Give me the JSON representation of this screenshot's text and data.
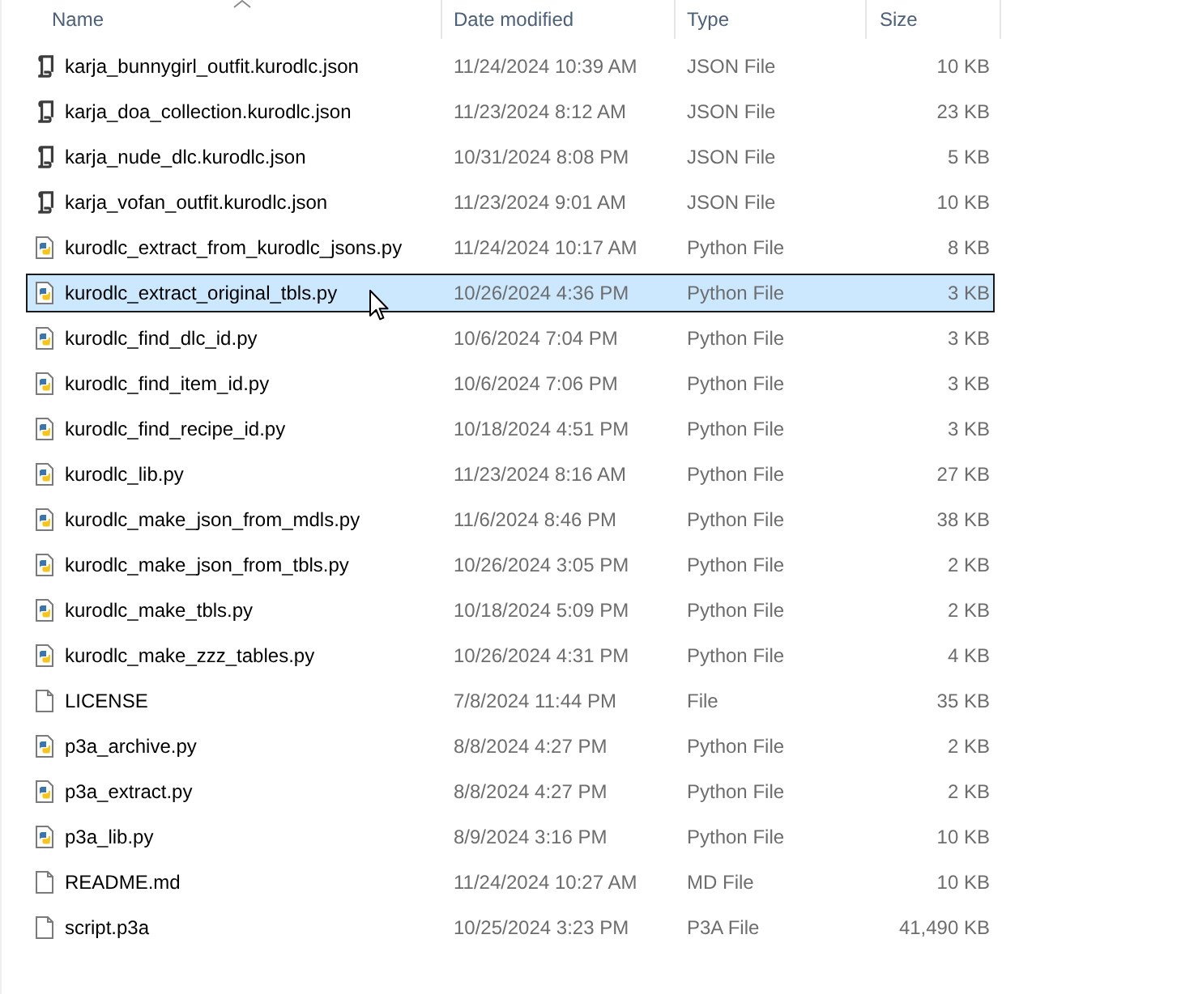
{
  "columns": [
    {
      "label": "Name",
      "sorted": true
    },
    {
      "label": "Date modified",
      "sorted": false
    },
    {
      "label": "Type",
      "sorted": false
    },
    {
      "label": "Size",
      "sorted": false
    }
  ],
  "rows": [
    {
      "kind": "script",
      "name": "karja_bunnygirl_outfit.kurodlc.json",
      "date_modified": "11/24/2024 10:39 AM",
      "type": "JSON File",
      "size": "10 KB",
      "selected": false
    },
    {
      "kind": "script",
      "name": "karja_doa_collection.kurodlc.json",
      "date_modified": "11/23/2024 8:12 AM",
      "type": "JSON File",
      "size": "23 KB",
      "selected": false
    },
    {
      "kind": "script",
      "name": "karja_nude_dlc.kurodlc.json",
      "date_modified": "10/31/2024 8:08 PM",
      "type": "JSON File",
      "size": "5 KB",
      "selected": false
    },
    {
      "kind": "script",
      "name": "karja_vofan_outfit.kurodlc.json",
      "date_modified": "11/23/2024 9:01 AM",
      "type": "JSON File",
      "size": "10 KB",
      "selected": false
    },
    {
      "kind": "python",
      "name": "kurodlc_extract_from_kurodlc_jsons.py",
      "date_modified": "11/24/2024 10:17 AM",
      "type": "Python File",
      "size": "8 KB",
      "selected": false
    },
    {
      "kind": "python",
      "name": "kurodlc_extract_original_tbls.py",
      "date_modified": "10/26/2024 4:36 PM",
      "type": "Python File",
      "size": "3 KB",
      "selected": true
    },
    {
      "kind": "python",
      "name": "kurodlc_find_dlc_id.py",
      "date_modified": "10/6/2024 7:04 PM",
      "type": "Python File",
      "size": "3 KB",
      "selected": false
    },
    {
      "kind": "python",
      "name": "kurodlc_find_item_id.py",
      "date_modified": "10/6/2024 7:06 PM",
      "type": "Python File",
      "size": "3 KB",
      "selected": false
    },
    {
      "kind": "python",
      "name": "kurodlc_find_recipe_id.py",
      "date_modified": "10/18/2024 4:51 PM",
      "type": "Python File",
      "size": "3 KB",
      "selected": false
    },
    {
      "kind": "python",
      "name": "kurodlc_lib.py",
      "date_modified": "11/23/2024 8:16 AM",
      "type": "Python File",
      "size": "27 KB",
      "selected": false
    },
    {
      "kind": "python",
      "name": "kurodlc_make_json_from_mdls.py",
      "date_modified": "11/6/2024 8:46 PM",
      "type": "Python File",
      "size": "38 KB",
      "selected": false
    },
    {
      "kind": "python",
      "name": "kurodlc_make_json_from_tbls.py",
      "date_modified": "10/26/2024 3:05 PM",
      "type": "Python File",
      "size": "2 KB",
      "selected": false
    },
    {
      "kind": "python",
      "name": "kurodlc_make_tbls.py",
      "date_modified": "10/18/2024 5:09 PM",
      "type": "Python File",
      "size": "2 KB",
      "selected": false
    },
    {
      "kind": "python",
      "name": "kurodlc_make_zzz_tables.py",
      "date_modified": "10/26/2024 4:31 PM",
      "type": "Python File",
      "size": "4 KB",
      "selected": false
    },
    {
      "kind": "blank",
      "name": "LICENSE",
      "date_modified": "7/8/2024 11:44 PM",
      "type": "File",
      "size": "35 KB",
      "selected": false
    },
    {
      "kind": "python",
      "name": "p3a_archive.py",
      "date_modified": "8/8/2024 4:27 PM",
      "type": "Python File",
      "size": "2 KB",
      "selected": false
    },
    {
      "kind": "python",
      "name": "p3a_extract.py",
      "date_modified": "8/8/2024 4:27 PM",
      "type": "Python File",
      "size": "2 KB",
      "selected": false
    },
    {
      "kind": "python",
      "name": "p3a_lib.py",
      "date_modified": "8/9/2024 3:16 PM",
      "type": "Python File",
      "size": "10 KB",
      "selected": false
    },
    {
      "kind": "blank",
      "name": "README.md",
      "date_modified": "11/24/2024 10:27 AM",
      "type": "MD File",
      "size": "10 KB",
      "selected": false
    },
    {
      "kind": "blank",
      "name": "script.p3a",
      "date_modified": "10/25/2024 3:23 PM",
      "type": "P3A File",
      "size": "41,490 KB",
      "selected": false
    }
  ]
}
